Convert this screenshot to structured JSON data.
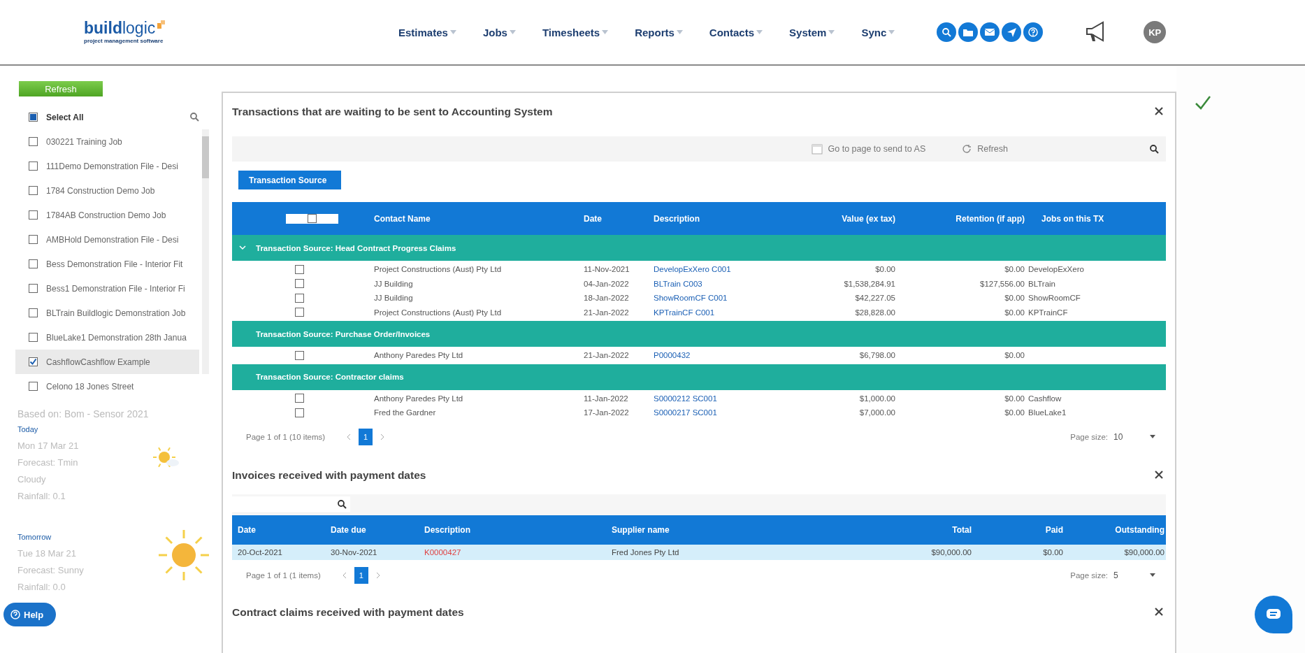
{
  "header": {
    "logo": {
      "name_bold": "build",
      "name_light": "logic",
      "tagline": "project management software"
    },
    "nav": [
      "Estimates",
      "Jobs",
      "Timesheets",
      "Reports",
      "Contacts",
      "System",
      "Sync"
    ],
    "avatar": "KP"
  },
  "sidebar": {
    "refresh": "Refresh",
    "select_all": {
      "label": "Select All",
      "checked": true
    },
    "jobs": [
      {
        "label": "030221 Training Job",
        "checked": false
      },
      {
        "label": "111Demo Demonstration File  - Desi",
        "checked": false
      },
      {
        "label": "1784 Construction Demo Job",
        "checked": false
      },
      {
        "label": "1784AB Construction Demo Job",
        "checked": false
      },
      {
        "label": "AMBHold Demonstration File  - Desi",
        "checked": false
      },
      {
        "label": "Bess Demonstration File  - Interior Fit",
        "checked": false
      },
      {
        "label": "Bess1 Demonstration File - Interior Fi",
        "checked": false
      },
      {
        "label": "BLTrain Buildlogic Demonstration Job",
        "checked": false
      },
      {
        "label": "BlueLake1 Demonstration 28th Janua",
        "checked": false
      },
      {
        "label": "CashflowCashflow Example",
        "checked": true
      },
      {
        "label": "Celono 18 Jones Street",
        "checked": false
      }
    ],
    "weather": {
      "source": "Based on: Bom - Sensor 2021",
      "days": [
        {
          "heading": "Today",
          "lines": [
            "Mon 17 Mar 21",
            "Forecast: Tmin",
            "Cloudy",
            "Rainfall: 0.1"
          ],
          "kind": "partly"
        },
        {
          "heading": "Tomorrow",
          "lines": [
            "Tue 18 Mar 21",
            "Forecast: Sunny",
            "Rainfall: 0.0"
          ],
          "kind": "sunny"
        }
      ]
    },
    "help": "Help"
  },
  "transactions": {
    "title": "Transactions that are waiting to be sent to Accounting System",
    "toolbar": {
      "goto": "Go to page to send to AS",
      "refresh": "Refresh"
    },
    "group_button": "Transaction Source",
    "columns": [
      "Contact Name",
      "Date",
      "Description",
      "Value (ex tax)",
      "Retention (if app)",
      "Jobs on this TX"
    ],
    "header_checked": false,
    "groups": [
      {
        "title": "Transaction Source: Head Contract Progress Claims",
        "expanded": true,
        "rows": [
          {
            "checked": false,
            "contact": "Project Constructions (Aust) Pty Ltd",
            "date": "11-Nov-2021",
            "description": "DevelopExXero C001",
            "value": "$0.00",
            "retention": "$0.00",
            "jobs": "DevelopExXero"
          },
          {
            "checked": false,
            "contact": "JJ Building",
            "date": "04-Jan-2022",
            "description": "BLTrain C003",
            "value": "$1,538,284.91",
            "retention": "$127,556.00",
            "jobs": "BLTrain"
          },
          {
            "checked": false,
            "contact": "JJ Building",
            "date": "18-Jan-2022",
            "description": "ShowRoomCF C001",
            "value": "$42,227.05",
            "retention": "$0.00",
            "jobs": "ShowRoomCF"
          },
          {
            "checked": false,
            "contact": "Project Constructions (Aust) Pty Ltd",
            "date": "21-Jan-2022",
            "description": "KPTrainCF C001",
            "value": "$28,828.00",
            "retention": "$0.00",
            "jobs": "KPTrainCF"
          }
        ]
      },
      {
        "title": "Transaction Source: Purchase Order/Invoices",
        "expanded": false,
        "rows": [
          {
            "checked": false,
            "contact": "Anthony Paredes Pty Ltd",
            "date": "21-Jan-2022",
            "description": "P0000432",
            "value": "$6,798.00",
            "retention": "$0.00",
            "jobs": ""
          }
        ]
      },
      {
        "title": "Transaction Source: Contractor claims",
        "expanded": false,
        "rows": [
          {
            "checked": false,
            "contact": "Anthony Paredes Pty Ltd",
            "date": "11-Jan-2022",
            "description": "S0000212 SC001",
            "value": "$1,000.00",
            "retention": "$0.00",
            "jobs": "Cashflow"
          },
          {
            "checked": false,
            "contact": "Fred the Gardner",
            "date": "17-Jan-2022",
            "description": "S0000217 SC001",
            "value": "$7,000.00",
            "retention": "$0.00",
            "jobs": "BlueLake1"
          }
        ]
      }
    ],
    "pager": {
      "info": "Page 1 of 1 (10 items)",
      "pages": [
        {
          "label": "1",
          "selected": true
        }
      ],
      "size_label": "Page size:",
      "size": "10"
    }
  },
  "invoices": {
    "title": "Invoices received with payment dates",
    "columns": [
      "Date",
      "Date due",
      "Description",
      "Supplier name",
      "Total",
      "Paid",
      "Outstanding"
    ],
    "rows": [
      {
        "selected": true,
        "date": "20-Oct-2021",
        "due": "30-Nov-2021",
        "description": "K0000427",
        "supplier": "Fred Jones Pty Ltd",
        "total": "$90,000.00",
        "paid": "$0.00",
        "outstanding": "$90,000.00"
      }
    ],
    "pager": {
      "info": "Page 1 of 1 (1 items)",
      "pages": [
        {
          "label": "1",
          "selected": true
        }
      ],
      "size_label": "Page size:",
      "size": "5"
    }
  },
  "claims": {
    "title": "Contract claims received with payment dates"
  }
}
